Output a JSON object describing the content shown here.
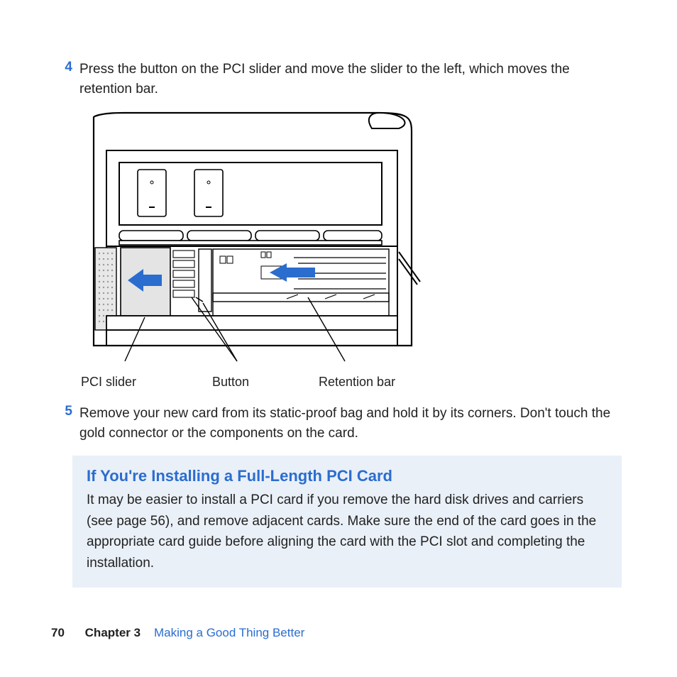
{
  "steps": [
    {
      "num": "4",
      "text": "Press the button on the PCI slider and move the slider to the left, which moves the retention bar."
    },
    {
      "num": "5",
      "text": "Remove your new card from its static-proof bag and hold it by its corners. Don't touch the gold connector or the components on the card."
    }
  ],
  "figure_labels": {
    "pci_slider": "PCI slider",
    "button": "Button",
    "retention_bar": "Retention bar"
  },
  "callout": {
    "title": "If You're Installing a Full-Length PCI Card",
    "body": "It may be easier to install a PCI card if you remove the hard disk drives and carriers (see page 56), and remove adjacent cards. Make sure the end of the card goes in the appropriate card guide before aligning the card with the PCI slot and completing the installation."
  },
  "footer": {
    "page_number": "70",
    "chapter_label": "Chapter 3",
    "chapter_title": "Making a Good Thing Better"
  },
  "colors": {
    "accent": "#2a6dcf",
    "callout_bg": "#eaf0f8"
  }
}
